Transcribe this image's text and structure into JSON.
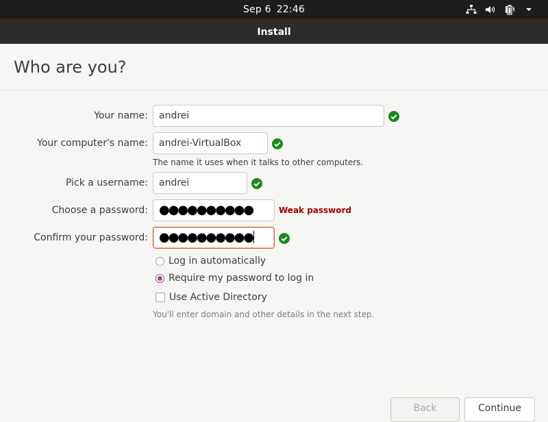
{
  "topbar": {
    "date": "Sep 6",
    "time": "22:46",
    "icons": [
      "network-icon",
      "volume-icon",
      "battery-icon"
    ]
  },
  "window": {
    "title": "Install"
  },
  "page": {
    "heading": "Who are you?"
  },
  "form": {
    "name": {
      "label": "Your name:",
      "value": "andrei"
    },
    "computer_name": {
      "label": "Your computer's name:",
      "value": "andrei-VirtualBox",
      "hint": "The name it uses when it talks to other computers."
    },
    "username": {
      "label": "Pick a username:",
      "value": "andrei"
    },
    "password": {
      "label": "Choose a password:",
      "value": "●●●●●●●●●●",
      "strength": "Weak password"
    },
    "confirm_password": {
      "label": "Confirm your password:",
      "value": "●●●●●●●●●●"
    },
    "login_auto": {
      "label": "Log in automatically",
      "checked": false
    },
    "require_password": {
      "label": "Require my password to log in",
      "checked": true
    },
    "active_directory": {
      "label": "Use Active Directory",
      "checked": false,
      "hint": "You'll enter domain and other details in the next step."
    }
  },
  "buttons": {
    "back": "Back",
    "continue": "Continue"
  },
  "colors": {
    "accent": "#e95420",
    "ok": "#1b8a1b",
    "radio": "#924d8b",
    "warning": "#a40000"
  }
}
